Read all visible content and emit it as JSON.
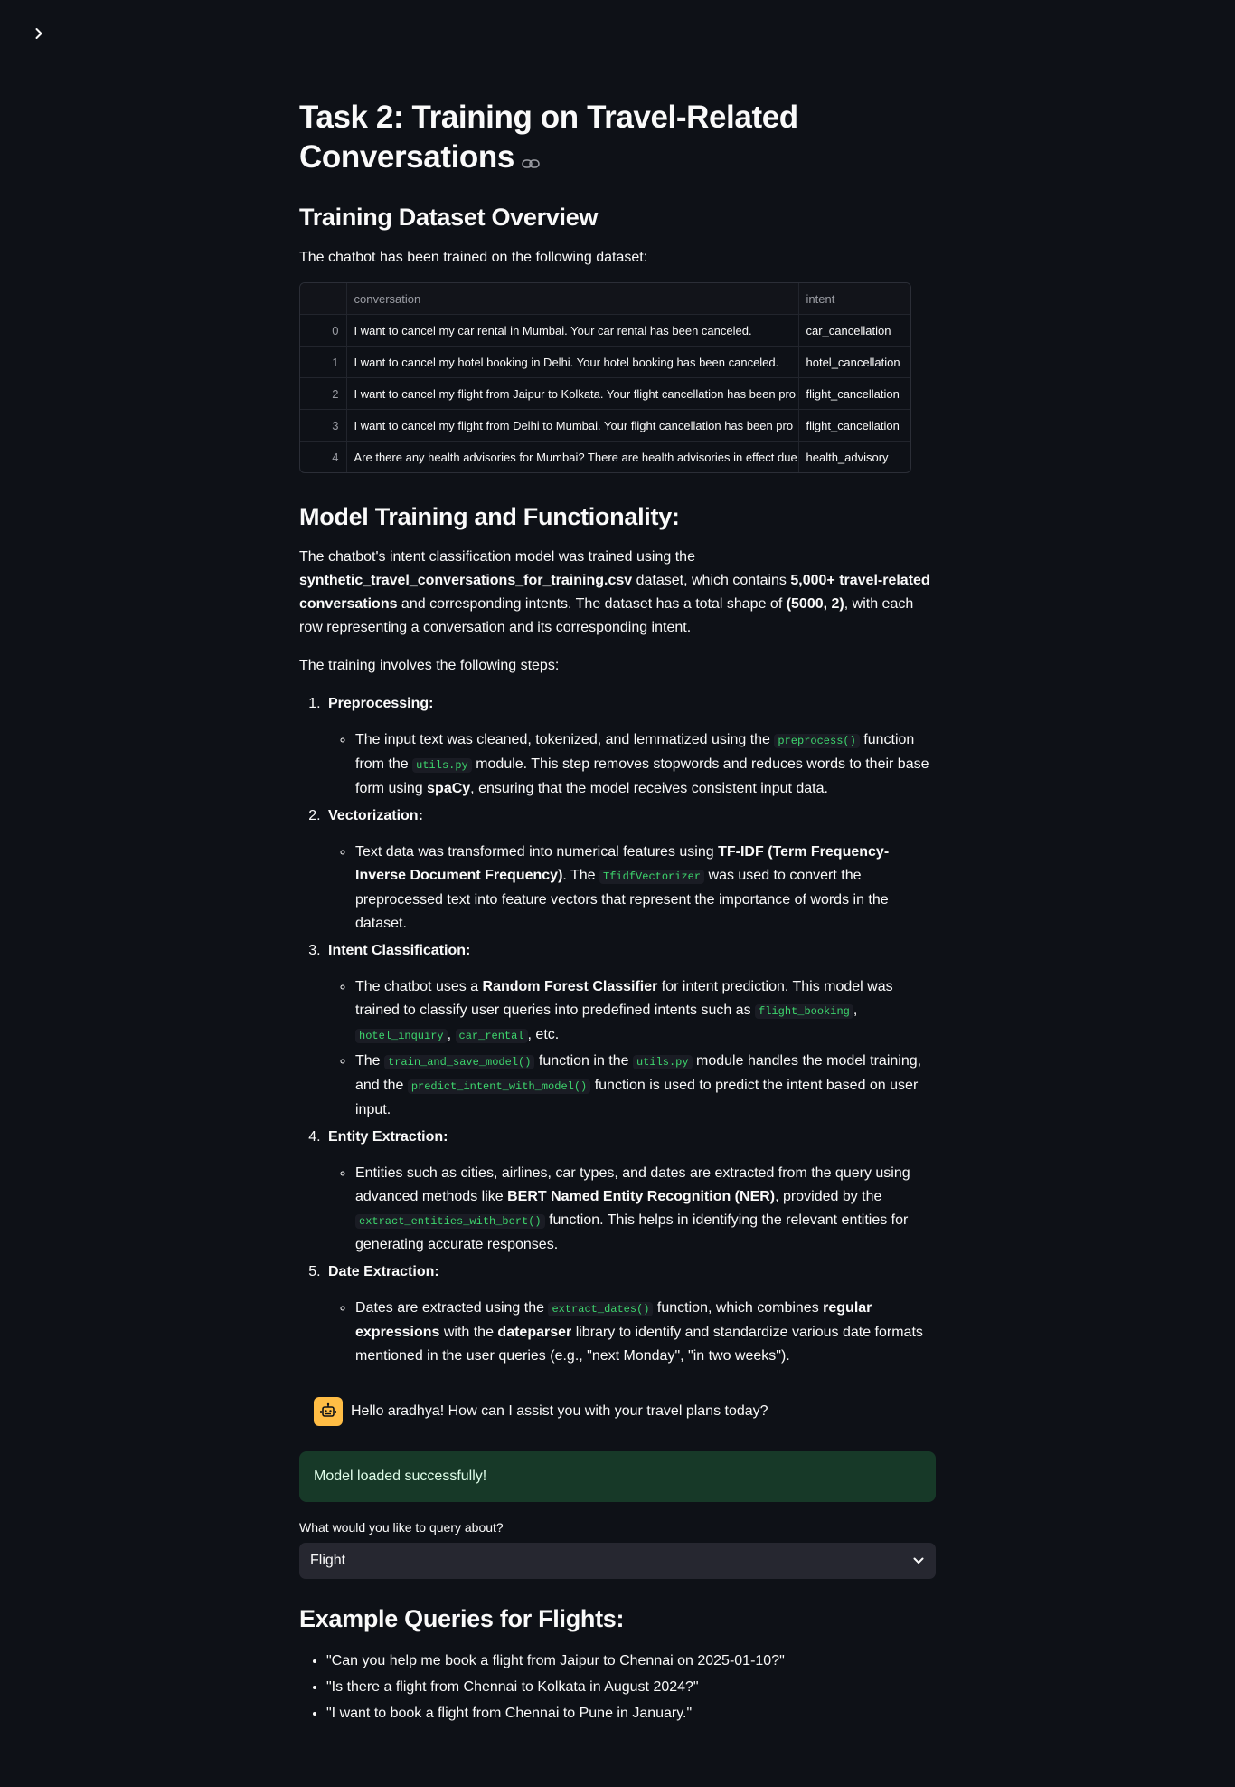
{
  "page": {
    "title": "Task 2: Training on Travel-Related Conversations"
  },
  "dataset": {
    "heading": "Training Dataset Overview",
    "intro": "The chatbot has been trained on the following dataset:",
    "columns": [
      "",
      "conversation",
      "intent"
    ],
    "rows": [
      {
        "index": "0",
        "conversation": "I want to cancel my car rental in Mumbai. Your car rental has been canceled.",
        "intent": "car_cancellation"
      },
      {
        "index": "1",
        "conversation": "I want to cancel my hotel booking in Delhi. Your hotel booking has been canceled.",
        "intent": "hotel_cancellation"
      },
      {
        "index": "2",
        "conversation": "I want to cancel my flight from Jaipur to Kolkata. Your flight cancellation has been pro",
        "intent": "flight_cancellation"
      },
      {
        "index": "3",
        "conversation": "I want to cancel my flight from Delhi to Mumbai. Your flight cancellation has been pro",
        "intent": "flight_cancellation"
      },
      {
        "index": "4",
        "conversation": "Are there any health advisories for Mumbai? There are health advisories in effect due",
        "intent": "health_advisory"
      }
    ]
  },
  "model": {
    "heading": "Model Training and Functionality:",
    "p1": {
      "t1": "The chatbot's intent classification model was trained using the ",
      "b1": "synthetic_travel_conversations_for_training.csv",
      "t2": " dataset, which contains ",
      "b2": "5,000+ travel-related conversations",
      "t3": " and corresponding intents. The dataset has a total shape of ",
      "b3": "(5000, 2)",
      "t4": ", with each row representing a conversation and its corresponding intent."
    },
    "p2": "The training involves the following steps:",
    "steps": {
      "s1": {
        "title": "Preprocessing:",
        "t1": "The input text was cleaned, tokenized, and lemmatized using the ",
        "c1": "preprocess()",
        "t2": " function from the ",
        "c2": "utils.py",
        "t3": " module. This step removes stopwords and reduces words to their base form using ",
        "b1": "spaCy",
        "t4": ", ensuring that the model receives consistent input data."
      },
      "s2": {
        "title": "Vectorization:",
        "t1": "Text data was transformed into numerical features using ",
        "b1": "TF-IDF (Term Frequency-Inverse Document Frequency)",
        "t2": ". The ",
        "c1": "TfidfVectorizer",
        "t3": " was used to convert the preprocessed text into feature vectors that represent the importance of words in the dataset."
      },
      "s3": {
        "title": "Intent Classification:",
        "a": {
          "t1": "The chatbot uses a ",
          "b1": "Random Forest Classifier",
          "t2": " for intent prediction. This model was trained to classify user queries into predefined intents such as ",
          "c1": "flight_booking",
          "t3": ", ",
          "c2": "hotel_inquiry",
          "t4": ", ",
          "c3": "car_rental",
          "t5": ", etc."
        },
        "b": {
          "t1": "The ",
          "c1": "train_and_save_model()",
          "t2": " function in the ",
          "c2": "utils.py",
          "t3": " module handles the model training, and the ",
          "c3": "predict_intent_with_model()",
          "t4": " function is used to predict the intent based on user input."
        }
      },
      "s4": {
        "title": "Entity Extraction:",
        "t1": "Entities such as cities, airlines, car types, and dates are extracted from the query using advanced methods like ",
        "b1": "BERT Named Entity Recognition (NER)",
        "t2": ", provided by the ",
        "c1": "extract_entities_with_bert()",
        "t3": " function. This helps in identifying the relevant entities for generating accurate responses."
      },
      "s5": {
        "title": "Date Extraction:",
        "t1": "Dates are extracted using the ",
        "c1": "extract_dates()",
        "t2": " function, which combines ",
        "b1": "regular expressions",
        "t3": " with the ",
        "b2": "dateparser",
        "t4": " library to identify and standardize various date formats mentioned in the user queries (e.g., \"next Monday\", \"in two weeks\")."
      }
    }
  },
  "chat": {
    "message": "Hello aradhya! How can I assist you with your travel plans today?",
    "avatar_icon": "robot-icon",
    "avatar_color": "#ffbd45"
  },
  "status": {
    "success_text": "Model loaded successfully!",
    "success_bg": "#173928"
  },
  "query": {
    "label": "What would you like to query about?",
    "selected": "Flight"
  },
  "examples": {
    "heading": "Example Queries for Flights:",
    "items": [
      "\"Can you help me book a flight from Jaipur to Chennai on 2025-01-10?\"",
      "\"Is there a flight from Chennai to Kolkata in August 2024?\"",
      "\"I want to book a flight from Chennai to Pune in January.\""
    ]
  }
}
